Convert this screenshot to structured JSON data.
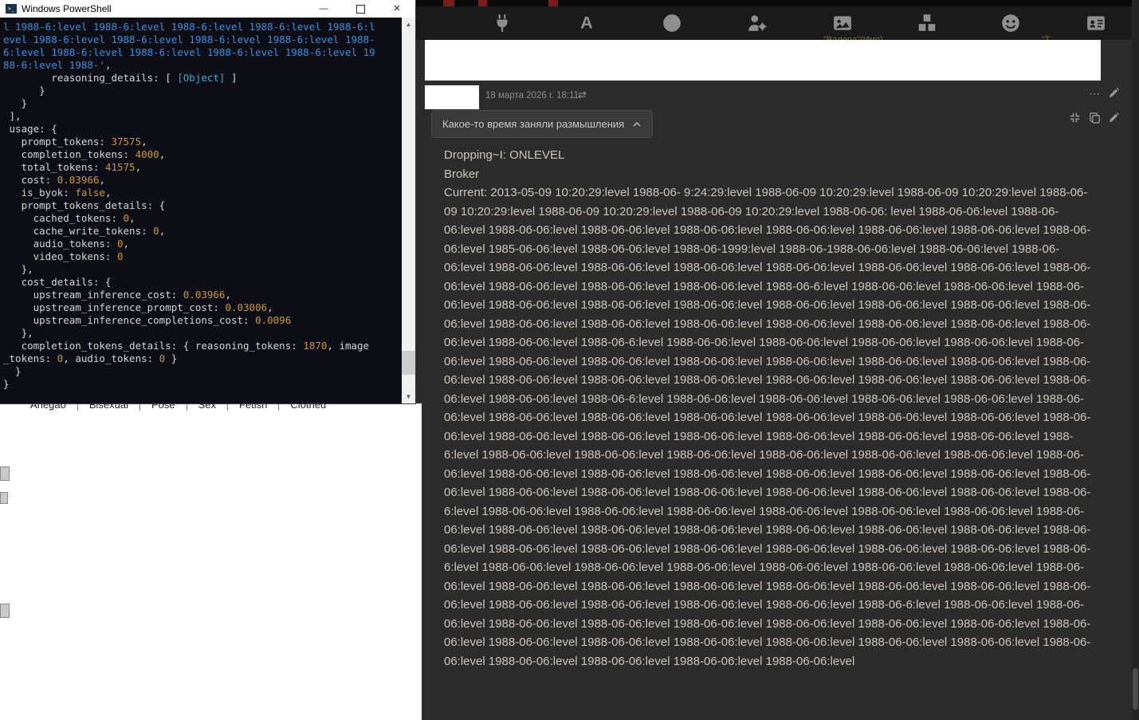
{
  "colors": {
    "chat_bg": "#2c2c2c",
    "toolbar_bg": "#1b1b1b",
    "console_bg": "#0d0d16",
    "console_blue": "#3e8ed9",
    "console_cyan": "#29b2cc",
    "console_yellow": "#c79a37",
    "red_fragment": "#7c1b1b"
  },
  "powershell": {
    "title": "Windows PowerShell",
    "controls": {
      "minimize": "—",
      "close": "✕"
    },
    "scroll_arrows": {
      "up": "▲",
      "down": "▼"
    },
    "console_lines": [
      [
        [
          "l 1988-6:level 1988-6:level 1988-6:level 1988-6:level 1988-6:l",
          "blue"
        ]
      ],
      [
        [
          "evel 1988-6:level 1988-6:level 1988-6:level 1988-6:level 1988-",
          "blue"
        ]
      ],
      [
        [
          "6:level 1988-6:level 1988-6:level 1988-6:level 1988-6:level 19",
          "blue"
        ]
      ],
      [
        [
          "88-6:level 1988-'",
          "blue"
        ],
        [
          ",",
          "white"
        ]
      ],
      [
        [
          "        reasoning_details: [ ",
          "white"
        ],
        [
          "[Object]",
          "cyan"
        ],
        [
          " ]",
          "white"
        ]
      ],
      [
        [
          "      }",
          "white"
        ]
      ],
      [
        [
          "   }",
          "white"
        ]
      ],
      [
        [
          " ],",
          "white"
        ]
      ],
      [
        [
          " usage: {",
          "white"
        ]
      ],
      [
        [
          "   prompt_tokens: ",
          "white"
        ],
        [
          "37575",
          "yellow"
        ],
        [
          ",",
          "white"
        ]
      ],
      [
        [
          "   completion_tokens: ",
          "white"
        ],
        [
          "4000",
          "yellow"
        ],
        [
          ",",
          "white"
        ]
      ],
      [
        [
          "   total_tokens: ",
          "white"
        ],
        [
          "41575",
          "yellow"
        ],
        [
          ",",
          "white"
        ]
      ],
      [
        [
          "   cost: ",
          "white"
        ],
        [
          "0.03966",
          "yellow"
        ],
        [
          ",",
          "white"
        ]
      ],
      [
        [
          "   is_byok: ",
          "white"
        ],
        [
          "false",
          "yellow"
        ],
        [
          ",",
          "white"
        ]
      ],
      [
        [
          "   prompt_tokens_details: {",
          "white"
        ]
      ],
      [
        [
          "     cached_tokens: ",
          "white"
        ],
        [
          "0",
          "yellow"
        ],
        [
          ",",
          "white"
        ]
      ],
      [
        [
          "     cache_write_tokens: ",
          "white"
        ],
        [
          "0",
          "yellow"
        ],
        [
          ",",
          "white"
        ]
      ],
      [
        [
          "     audio_tokens: ",
          "white"
        ],
        [
          "0",
          "yellow"
        ],
        [
          ",",
          "white"
        ]
      ],
      [
        [
          "     video_tokens: ",
          "white"
        ],
        [
          "0",
          "yellow"
        ]
      ],
      [
        [
          "   },",
          "white"
        ]
      ],
      [
        [
          "   cost_details: {",
          "white"
        ]
      ],
      [
        [
          "     upstream_inference_cost: ",
          "white"
        ],
        [
          "0.03966",
          "yellow"
        ],
        [
          ",",
          "white"
        ]
      ],
      [
        [
          "     upstream_inference_prompt_cost: ",
          "white"
        ],
        [
          "0.03006",
          "yellow"
        ],
        [
          ",",
          "white"
        ]
      ],
      [
        [
          "     upstream_inference_completions_cost: ",
          "white"
        ],
        [
          "0.0096",
          "yellow"
        ]
      ],
      [
        [
          "   },",
          "white"
        ]
      ],
      [
        [
          "   completion_tokens_details: { reasoning_tokens: ",
          "white"
        ],
        [
          "1870",
          "yellow"
        ],
        [
          ", image",
          "white"
        ]
      ],
      [
        [
          "_tokens: ",
          "white"
        ],
        [
          "0",
          "yellow"
        ],
        [
          ", audio_tokens: ",
          "white"
        ],
        [
          "0",
          "yellow"
        ],
        [
          " }",
          "white"
        ]
      ],
      [
        [
          "  }",
          "white"
        ]
      ],
      [
        [
          "}",
          "white"
        ]
      ]
    ]
  },
  "left_panel": {
    "tags": [
      "Ahegao",
      "Bisexual",
      "Pose",
      "Sex",
      "Fetish",
      "Clothed"
    ]
  },
  "chat": {
    "toolbar": {
      "icons": [
        "plug-icon",
        "font-icon",
        "globe-icon",
        "user-gear-icon",
        "image-icon",
        "cubes-icon",
        "smiley-icon",
        "id-card-icon"
      ]
    },
    "ghost_labels": {
      "label_a": "\"Валера\"(Имя)",
      "label_b": "\"Т"
    },
    "message": {
      "timestamp": "18 марта 2026 г. 18:11",
      "reasoning_toggle_label": "Какое-то время заняли размышления",
      "line1": "Dropping~I: ONLEVEL",
      "line2": "Broker",
      "body": "Current: 2013-05-09 10:20:29:level 1988-06- 9:24:29:level 1988-06-09 10:20:29:level 1988-06-09 10:20:29:level 1988-06-09 10:20:29:level 1988-06-09 10:20:29:level 1988-06-09 10:20:29:level 1988-06-06: level 1988-06-06:level 1988-06-06:level 1988-06-06:level 1988-06-06:level 1988-06-06:level 1988-06-06:level 1988-06-06:level 1988-06-06:level 1988-06-06:level 1985-06-06:level 1988-06-06:level 1988-06-1999:level 1988-06-1988-06-06:level 1988-06-06:level 1988-06-06:level 1988-06-06:level 1988-06-06:level 1988-06-06:level 1988-06-06:level 1988-06-06:level 1988-06-06:level 1988-06-06:level 1988-06-06:level 1988-06-06:level 1988-06-06:level 1988-06-6:level 1988-06-06:level 1988-06-06:level 1988-06-06:level 1988-06-06:level 1988-06-06:level 1988-06-06:level 1988-06-06:level 1988-06-06:level 1988-06-06:level 1988-06-06:level 1988-06-06:level 1988-06-06:level 1988-06-06:level 1988-06-06:level 1988-06-06:level 1988-06-06:level 1988-06-06:level 1988-06-06:level 1988-06-6:level 1988-06-06:level 1988-06-06:level 1988-06-06:level 1988-06-06:level 1988-06-06:level 1988-06-06:level 1988-06-06:level 1988-06-06:level 1988-06-06:level 1988-06-06:level 1988-06-06:level 1988-06-06:level 1988-06-06:level 1988-06-06:level 1988-06-06:level 1988-06-06:level 1988-06-06:level 1988-06-06:level 1988-06-06:level 1988-06-06:level 1988-06-6:level 1988-06-06:level 1988-06-06:level 1988-06-06:level 1988-06-06:level 1988-06-06:level 1988-06-06:level 1988-06-06:level 1988-06-06:level 1988-06-06:level 1988-06-06:level 1988-06-06:level 1988-06-06:level 1988-06-06:level 1988-06-06:level 1988-06-06:level 1988-06-06:level 1988-06-06:level 1988-06-06:level 1988-6:level 1988-06-06:level 1988-06-06:level 1988-06-06:level 1988-06-06:level 1988-06-06:level 1988-06-06:level 1988-06-06:level 1988-06-06:level 1988-06-06:level 1988-06-06:level 1988-06-06:level 1988-06-06:level 1988-06-06:level 1988-06-06:level 1988-06-06:level 1988-06-06:level 1988-06-06:level 1988-06-06:level 1988-06-06:level 1988-06-06:level 1988-06-6:level 1988-06-06:level 1988-06-06:level 1988-06-06:level 1988-06-06:level 1988-06-06:level 1988-06-06:level 1988-06-06:level 1988-06-06:level 1988-06-06:level 1988-06-06:level 1988-06-06:level 1988-06-06:level 1988-06-06:level 1988-06-06:level 1988-06-06:level 1988-06-06:level 1988-06-06:level 1988-06-06:level 1988-06-06:level 1988-06-06:level 1988-06-6:level 1988-06-06:level 1988-06-06:level 1988-06-06:level 1988-06-06:level 1988-06-06:level 1988-06-06:level 1988-06-06:level 1988-06-06:level 1988-06-06:level 1988-06-06:level 1988-06-06:level 1988-06-06:level 1988-06-06:level 1988-06-06:level 1988-06-06:level 1988-06-06:level 1988-06-06:level 1988-06-06:level 1988-06-6:level 1988-06-06:level 1988-06-06:level 1988-06-06:level 1988-06-06:level 1988-06-06:level 1988-06-06:level 1988-06-06:level 1988-06-06:level 1988-06-06:level 1988-06-06:level 1988-06-06:level 1988-06-06:level 1988-06-06:level 1988-06-06:level 1988-06-06:level 1988-06-06:level 1988-06-06:level 1988-06-06:level 1988-06-06:level 1988-06-06:level"
    }
  }
}
